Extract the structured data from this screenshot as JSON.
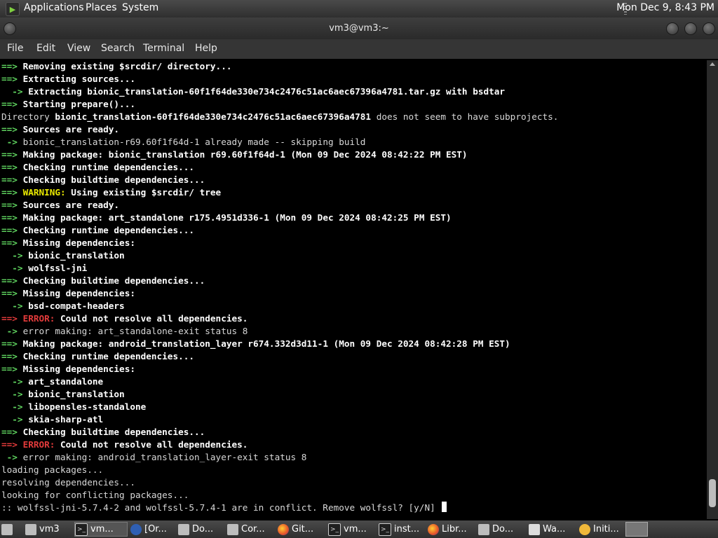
{
  "top_panel": {
    "menus": [
      "Applications",
      "Places",
      "System"
    ],
    "clock": "Mon Dec 9,  8:43 PM"
  },
  "window": {
    "title": "vm3@vm3:~"
  },
  "menubar": [
    "File",
    "Edit",
    "View",
    "Search",
    "Terminal",
    "Help"
  ],
  "terminal": {
    "lines": [
      [
        [
          "==> ",
          "g"
        ],
        [
          "Removing existing $srcdir/ directory...",
          "b"
        ]
      ],
      [
        [
          "==> ",
          "g"
        ],
        [
          "Extracting sources...",
          "b"
        ]
      ],
      [
        [
          "  -> ",
          "g"
        ],
        [
          "Extracting bionic_translation-60f1f64de330e734c2476c51ac6aec67396a4781.tar.gz with bsdtar",
          "b"
        ]
      ],
      [
        [
          "==> ",
          "g"
        ],
        [
          "Starting prepare()...",
          "b"
        ]
      ],
      [
        [
          "Directory ",
          ""
        ],
        [
          "bionic_translation-60f1f64de330e734c2476c51ac6aec67396a4781",
          "b"
        ],
        [
          " does not seem to have subprojects.",
          ""
        ]
      ],
      [
        [
          "==> ",
          "g"
        ],
        [
          "Sources are ready.",
          "b"
        ]
      ],
      [
        [
          " -> ",
          "g"
        ],
        [
          "bionic_translation-r69.60f1f64d-1 already made -- skipping build",
          ""
        ]
      ],
      [
        [
          "==> ",
          "g"
        ],
        [
          "Making package: bionic_translation r69.60f1f64d-1 (Mon 09 Dec 2024 08:42:22 PM EST)",
          "b"
        ]
      ],
      [
        [
          "==> ",
          "g"
        ],
        [
          "Checking runtime dependencies...",
          "b"
        ]
      ],
      [
        [
          "==> ",
          "g"
        ],
        [
          "Checking buildtime dependencies...",
          "b"
        ]
      ],
      [
        [
          "==> ",
          "g"
        ],
        [
          "WARNING:",
          "y"
        ],
        [
          " Using existing $srcdir/ tree",
          "b"
        ]
      ],
      [
        [
          "==> ",
          "g"
        ],
        [
          "Sources are ready.",
          "b"
        ]
      ],
      [
        [
          "==> ",
          "g"
        ],
        [
          "Making package: art_standalone r175.4951d336-1 (Mon 09 Dec 2024 08:42:25 PM EST)",
          "b"
        ]
      ],
      [
        [
          "==> ",
          "g"
        ],
        [
          "Checking runtime dependencies...",
          "b"
        ]
      ],
      [
        [
          "==> ",
          "g"
        ],
        [
          "Missing dependencies:",
          "b"
        ]
      ],
      [
        [
          "  -> ",
          "g"
        ],
        [
          "bionic_translation",
          "b"
        ]
      ],
      [
        [
          "  -> ",
          "g"
        ],
        [
          "wolfssl-jni",
          "b"
        ]
      ],
      [
        [
          "==> ",
          "g"
        ],
        [
          "Checking buildtime dependencies...",
          "b"
        ]
      ],
      [
        [
          "==> ",
          "g"
        ],
        [
          "Missing dependencies:",
          "b"
        ]
      ],
      [
        [
          "  -> ",
          "g"
        ],
        [
          "bsd-compat-headers",
          "b"
        ]
      ],
      [
        [
          "==> ",
          "r"
        ],
        [
          "ERROR:",
          "r"
        ],
        [
          " Could not resolve all dependencies.",
          "b"
        ]
      ],
      [
        [
          " -> ",
          "g"
        ],
        [
          "error making: art_standalone-exit status 8",
          ""
        ]
      ],
      [
        [
          "==> ",
          "g"
        ],
        [
          "Making package: android_translation_layer r674.332d3d11-1 (Mon 09 Dec 2024 08:42:28 PM EST)",
          "b"
        ]
      ],
      [
        [
          "==> ",
          "g"
        ],
        [
          "Checking runtime dependencies...",
          "b"
        ]
      ],
      [
        [
          "==> ",
          "g"
        ],
        [
          "Missing dependencies:",
          "b"
        ]
      ],
      [
        [
          "  -> ",
          "g"
        ],
        [
          "art_standalone",
          "b"
        ]
      ],
      [
        [
          "  -> ",
          "g"
        ],
        [
          "bionic_translation",
          "b"
        ]
      ],
      [
        [
          "  -> ",
          "g"
        ],
        [
          "libopensles-standalone",
          "b"
        ]
      ],
      [
        [
          "  -> ",
          "g"
        ],
        [
          "skia-sharp-atl",
          "b"
        ]
      ],
      [
        [
          "==> ",
          "g"
        ],
        [
          "Checking buildtime dependencies...",
          "b"
        ]
      ],
      [
        [
          "==> ",
          "r"
        ],
        [
          "ERROR:",
          "r"
        ],
        [
          " Could not resolve all dependencies.",
          "b"
        ]
      ],
      [
        [
          " -> ",
          "g"
        ],
        [
          "error making: android_translation_layer-exit status 8",
          ""
        ]
      ],
      [
        [
          "loading packages...",
          ""
        ]
      ],
      [
        [
          "resolving dependencies...",
          ""
        ]
      ],
      [
        [
          "looking for conflicting packages...",
          ""
        ]
      ],
      [
        [
          ":: wolfssl-jni-5.7.4-2 and wolfssl-5.7.4-1 are in conflict. Remove wolfssl? [y/N] ",
          ""
        ]
      ]
    ]
  },
  "taskbar": [
    {
      "label": "vm3",
      "icon": "folder-icon"
    },
    {
      "label": "vm...",
      "icon": "terminal-icon"
    },
    {
      "label": "[Or...",
      "icon": "feed-icon"
    },
    {
      "label": "Do...",
      "icon": "folder-icon"
    },
    {
      "label": "Cor...",
      "icon": "folder-icon"
    },
    {
      "label": "Git...",
      "icon": "firefox-icon"
    },
    {
      "label": "vm...",
      "icon": "terminal-icon"
    },
    {
      "label": "inst...",
      "icon": "terminal-icon"
    },
    {
      "label": "Libr...",
      "icon": "firefox-icon"
    },
    {
      "label": "Do...",
      "icon": "folder-icon"
    },
    {
      "label": "Wa...",
      "icon": "text-editor-icon"
    },
    {
      "label": "Initi...",
      "icon": "steam-icon"
    }
  ]
}
